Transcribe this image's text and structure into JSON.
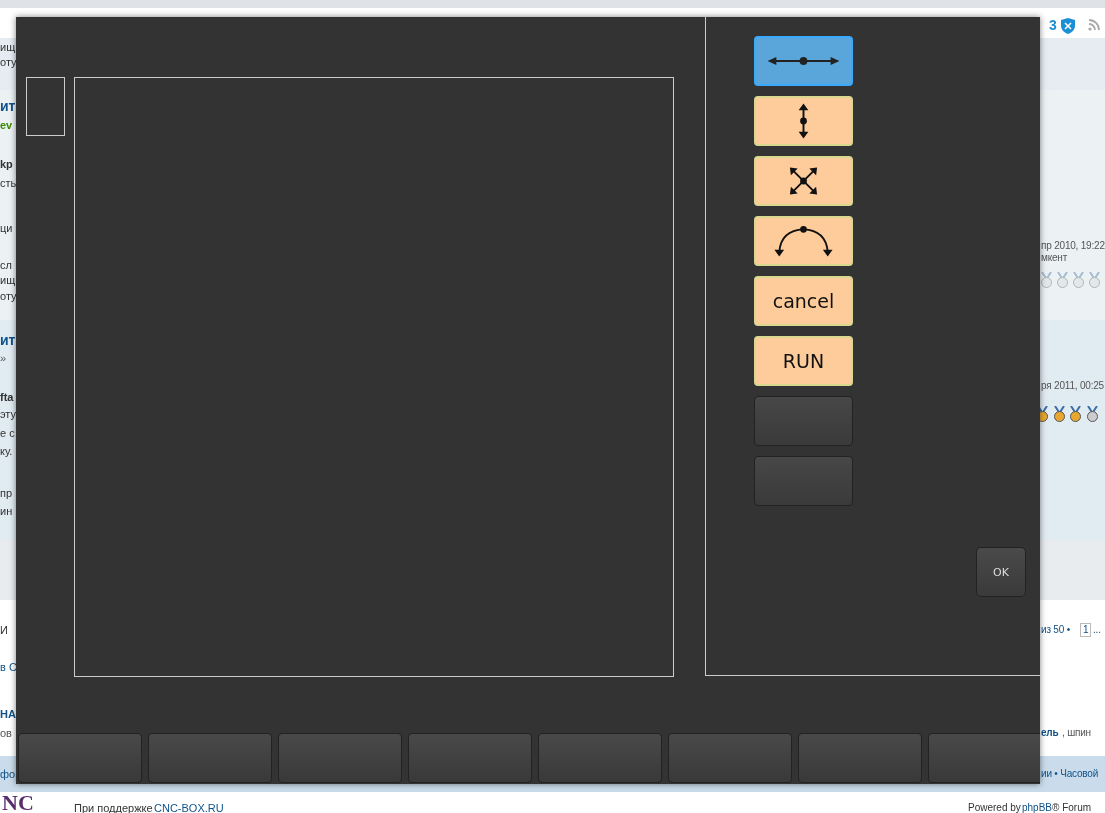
{
  "background": {
    "left_fragments": [
      {
        "text": "ищ",
        "kind": "text"
      },
      {
        "text": "оту",
        "kind": "text"
      },
      {
        "text": "ит",
        "kind": "title"
      },
      {
        "text": "ev",
        "kind": "user"
      },
      {
        "text": "kp",
        "kind": "bold"
      },
      {
        "text": "сть",
        "kind": "text"
      },
      {
        "text": "ци",
        "kind": "text"
      },
      {
        "text": "сл",
        "kind": "text"
      },
      {
        "text": "ищ",
        "kind": "text"
      },
      {
        "text": "оту",
        "kind": "text"
      },
      {
        "text": "ит",
        "kind": "title"
      },
      {
        "text": "»",
        "kind": "meta"
      },
      {
        "text": "fta",
        "kind": "bold"
      },
      {
        "text": "эту",
        "kind": "text"
      },
      {
        "text": "е с",
        "kind": "text"
      },
      {
        "text": "ку.",
        "kind": "text"
      },
      {
        "text": "пр",
        "kind": "text"
      },
      {
        "text": "ин",
        "kind": "text"
      },
      {
        "text": "И",
        "kind": "text"
      },
      {
        "text": "в С",
        "kind": "link"
      },
      {
        "text": "НА",
        "kind": "heading"
      },
      {
        "text": "ов",
        "kind": "meta"
      },
      {
        "text": "фо",
        "kind": "link"
      }
    ],
    "notification_count": "3",
    "right_fragments": [
      {
        "text": "пр 2010, 19:22",
        "kind": "meta"
      },
      {
        "text": "мкент",
        "kind": "meta"
      },
      {
        "text": "ря 2011, 00:25",
        "kind": "meta"
      },
      {
        "text": "из 50 •",
        "kind": "link"
      },
      {
        "text": "1",
        "kind": "page"
      },
      {
        "text": "...",
        "kind": "link"
      },
      {
        "text": "ель",
        "kind": "heading"
      },
      {
        "text": ", шпин",
        "kind": "meta"
      },
      {
        "text": "ии • Часовой",
        "kind": "link"
      }
    ],
    "logo": "NC",
    "footer_left": "При поддержке",
    "footer_link": "CNC-BOX.RU",
    "footer_right": "Powered by",
    "footer_right_link": "phpBB",
    "footer_right_tail": "® Forum"
  },
  "dialog": {
    "tool_buttons": [
      {
        "kind": "horizontal",
        "selected": true
      },
      {
        "kind": "vertical",
        "selected": false
      },
      {
        "kind": "all",
        "selected": false
      },
      {
        "kind": "arc",
        "selected": false
      },
      {
        "kind": "text",
        "label": "cancel",
        "selected": false
      },
      {
        "kind": "text",
        "label": "RUN",
        "selected": false
      },
      {
        "kind": "blank"
      },
      {
        "kind": "blank"
      }
    ],
    "ok_button": "OK",
    "soft_keys": [
      {
        "kind": "blank"
      },
      {
        "kind": "blank"
      },
      {
        "kind": "blank"
      },
      {
        "kind": "blank"
      },
      {
        "kind": "blank"
      },
      {
        "kind": "blank"
      },
      {
        "kind": "blank"
      },
      {
        "kind": "blank"
      }
    ]
  }
}
